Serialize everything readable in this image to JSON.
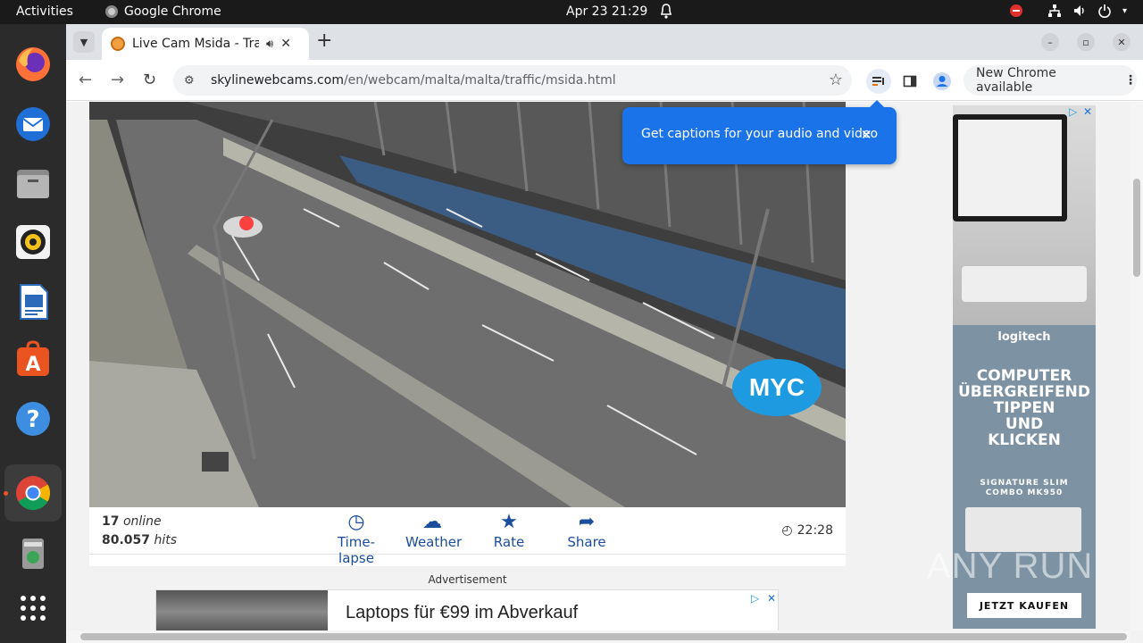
{
  "topbar": {
    "activities": "Activities",
    "app_name": "Google Chrome",
    "clock": "Apr 23  21:29"
  },
  "dock": {
    "items": [
      "firefox-icon",
      "thunderbird-icon",
      "files-icon",
      "rhythmbox-icon",
      "writer-icon",
      "software-icon",
      "help-icon",
      "chrome-icon",
      "trash-icon",
      "apps-grid-icon"
    ]
  },
  "browser": {
    "tab_title": "Live Cam Msida - Traffi",
    "url_domain": "skylinewebcams.com",
    "url_path": "/en/webcam/malta/malta/traffic/msida.html",
    "new_chrome_label": "New Chrome available",
    "popup_text": "Get captions for your audio and video"
  },
  "cam": {
    "logo_text": "MYC"
  },
  "infobar": {
    "online_count": "17",
    "online_label": "online",
    "hits_count": "80.057",
    "hits_label": "hits",
    "actions": [
      "Time-lapse",
      "Weather",
      "Rate",
      "Share"
    ],
    "time": "22:28"
  },
  "ad": {
    "label": "Advertisement",
    "headline": "Laptops für €99 im Abverkauf"
  },
  "side_ad": {
    "brand": "logitech",
    "headline_lines": [
      "COMPUTER",
      "ÜBERGREIFEND",
      "TIPPEN",
      "UND",
      "KLICKEN"
    ],
    "product_line1": "SIGNATURE SLIM",
    "product_line2": "COMBO MK950",
    "cta": "JETZT KAUFEN"
  },
  "watermark": "ANY RUN"
}
